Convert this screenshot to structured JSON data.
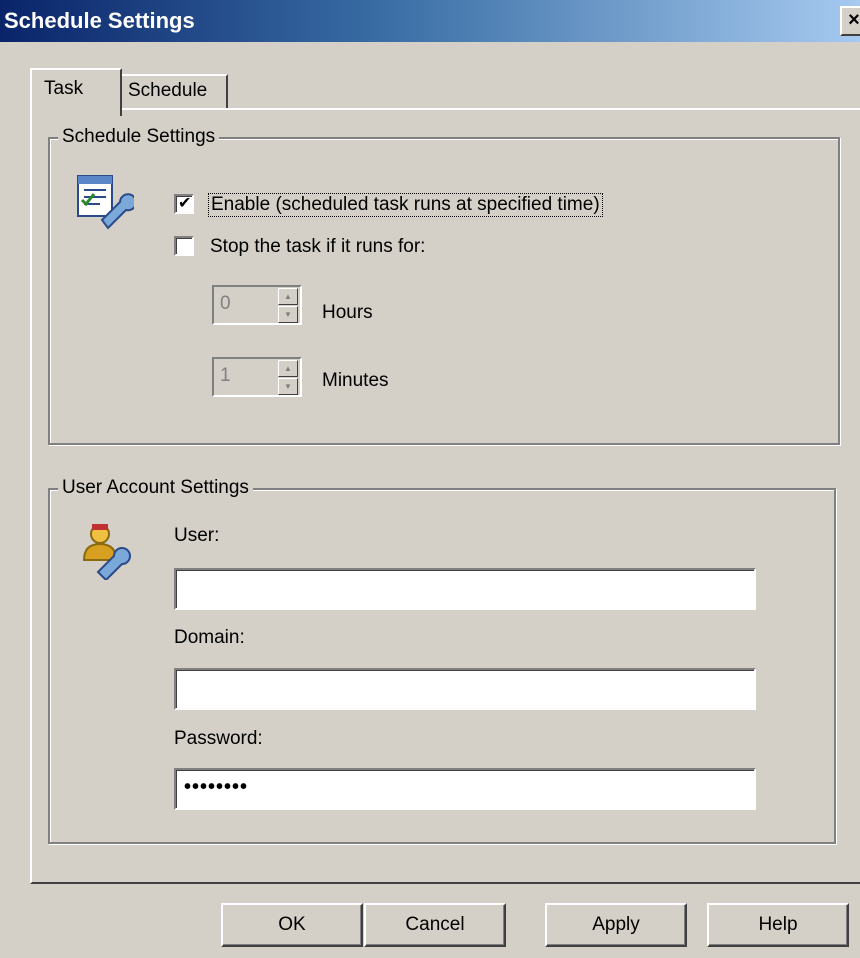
{
  "window": {
    "title": "Schedule Settings",
    "close_glyph": "×"
  },
  "tabs": [
    {
      "label": "Task",
      "active": true
    },
    {
      "label": "Schedule",
      "active": false
    }
  ],
  "schedule_group": {
    "legend": "Schedule Settings",
    "icon": "task-settings-icon",
    "enable": {
      "label": "Enable (scheduled task runs at specified time)",
      "checked": true
    },
    "stop": {
      "label": "Stop the task if it runs for:",
      "checked": false
    },
    "hours": {
      "value": "0",
      "label": "Hours"
    },
    "minutes": {
      "value": "1",
      "label": "Minutes"
    }
  },
  "account_group": {
    "legend": "User Account Settings",
    "icon": "user-settings-icon",
    "user": {
      "label": "User:",
      "value": ""
    },
    "domain": {
      "label": "Domain:",
      "value": ""
    },
    "password": {
      "label": "Password:",
      "value": "••••••••"
    }
  },
  "buttons": {
    "ok": "OK",
    "cancel": "Cancel",
    "apply": "Apply",
    "help": "Help"
  },
  "colors": {
    "titlebar_start": "#0a246a",
    "titlebar_end": "#a6caf0",
    "face": "#d4d0c8"
  }
}
